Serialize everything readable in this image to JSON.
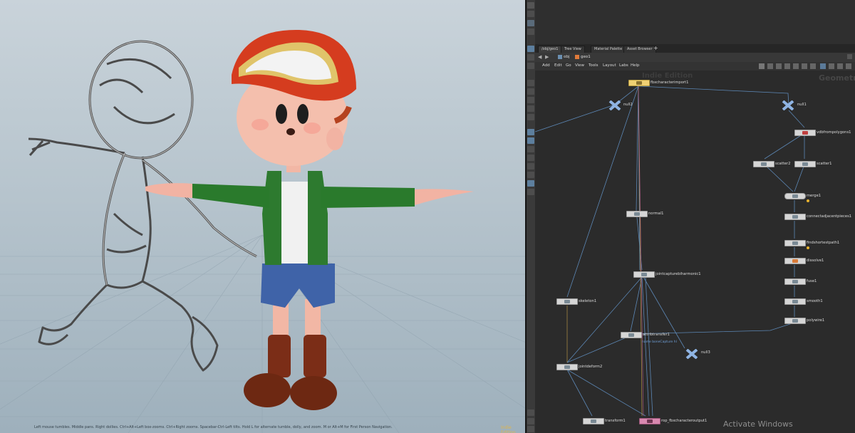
{
  "viewport": {
    "status_text": "Left mouse tumbles. Middle pans. Right dollies. Ctrl+Alt+Left box-zooms. Ctrl+Right zooms. Spacebar-Ctrl-Left tilts. Hold L for alternate tumble, dolly, and zoom. M or Alt+M for First Person Navigation.",
    "edition_badge": "Indie Edition"
  },
  "tabs": [
    {
      "label": "/obj/geo1"
    },
    {
      "label": "Tree View"
    },
    {
      "label": "Material Palette"
    },
    {
      "label": "Asset Browser"
    }
  ],
  "path": {
    "obj": "obj",
    "geo": "geo1"
  },
  "menu": [
    "Add",
    "Edit",
    "Go",
    "View",
    "Tools",
    "Layout",
    "Labs",
    "Help"
  ],
  "network": {
    "watermark_edition": "Indie Edition",
    "watermark_context": "Geometry",
    "activate_windows": "Activate Windows",
    "attr_sublabel": "name boneCapture hl",
    "nodes": {
      "fbxcharacterimport1": "fbxcharacterimport1",
      "null2": "null2",
      "null1": "null1",
      "vdbfrompolygons1": "vdbfrompolygons1",
      "scatter2": "scatter2",
      "scatter1": "scatter1",
      "merge1": "merge1",
      "normal1": "normal1",
      "connectadjacentpieces1": "connectadjacentpieces1",
      "findshortestpath1": "findshortestpath1",
      "dissolve1": "dissolve1",
      "jointcapturebiharmonic1": "jointcapturebiharmonic1",
      "fuse1": "fuse1",
      "skeleton1": "skeleton1",
      "smooth1": "smooth1",
      "polywire1": "polywire1",
      "attribtransfer1": "attribtransfer1",
      "null3": "null3",
      "jointdeform2": "jointdeform2",
      "transform1": "transform1",
      "rop_fbxcharacteroutput1": "rop_fbxcharacteroutput1"
    }
  },
  "colors": {
    "node_body": "#d6d6d6",
    "wire": "#5c87b5",
    "null_node": "#8fb4e3",
    "fbx_node": "#f0d173",
    "rop_node": "#d989b0",
    "warning": "#e8b22e"
  }
}
